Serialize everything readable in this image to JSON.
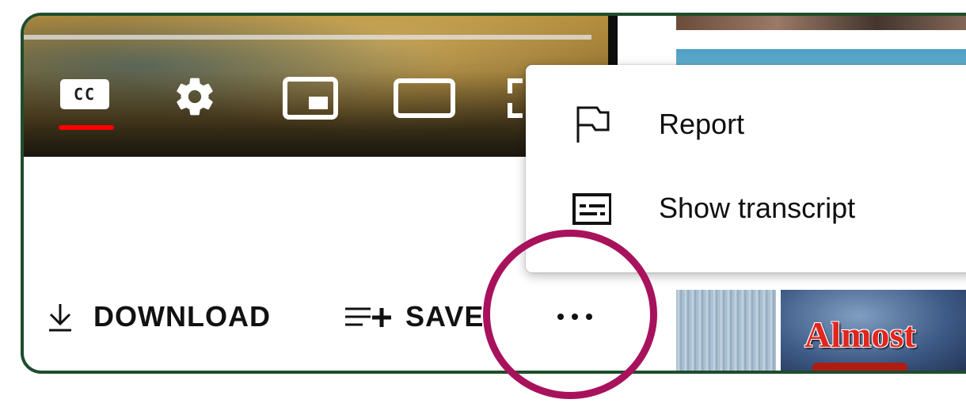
{
  "player": {
    "controls": {
      "captions_label": "CC"
    }
  },
  "actions": {
    "download_label": "DOWNLOAD",
    "save_label": "SAVE",
    "more_label": "..."
  },
  "menu": {
    "items": [
      {
        "label": "Report",
        "icon": "flag-icon"
      },
      {
        "label": "Show transcript",
        "icon": "transcript-icon"
      }
    ]
  },
  "thumbnails": {
    "almost_title": "Almost"
  },
  "colors": {
    "frame_border": "#1e4d2b",
    "captions_active": "#ff0000",
    "highlight_ring": "#a8125c"
  }
}
